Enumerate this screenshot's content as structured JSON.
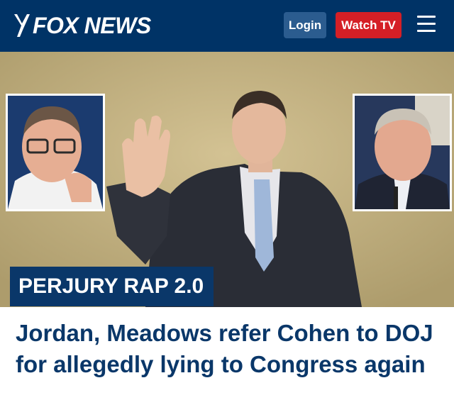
{
  "header": {
    "logo_text": "FOX NEWS",
    "login_label": "Login",
    "watch_label": "Watch TV",
    "menu_icon": "hamburger-menu-icon"
  },
  "story": {
    "kicker": "PERJURY RAP 2.0",
    "headline": "Jordan, Meadows refer Cohen to DOJ for allegedly lying to Congress again"
  },
  "colors": {
    "header_bg": "#003366",
    "login_bg": "#2b5c8f",
    "watch_bg": "#d51f26",
    "kicker_bg": "#0a3769",
    "headline_text": "#0a3769"
  }
}
